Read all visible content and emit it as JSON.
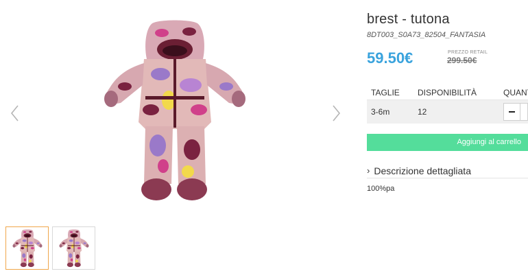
{
  "product": {
    "title": "brest - tutona",
    "sku": "8DT003_S0A73_82504_FANTASIA",
    "price": "59.50€",
    "retail_label": "PREZZO RETAIL",
    "retail_price": "299.50€"
  },
  "size_table": {
    "headers": [
      "TAGLIE",
      "DISPONIBILITÀ",
      "QUANTITÀ"
    ],
    "rows": [
      {
        "size": "3-6m",
        "availability": "12"
      }
    ]
  },
  "cart_button": "Aggiungi al carrello",
  "description": {
    "toggle_label": "Descrizione dettagliata",
    "text": "100%pa"
  },
  "colors": {
    "price": "#3aa3dd",
    "cart_button": "#54dd9b",
    "thumb_active_border": "#f0a64a"
  },
  "icons": {
    "prev": "chevron-left-icon",
    "next": "chevron-right-icon",
    "toggle": "chevron-right-icon"
  }
}
